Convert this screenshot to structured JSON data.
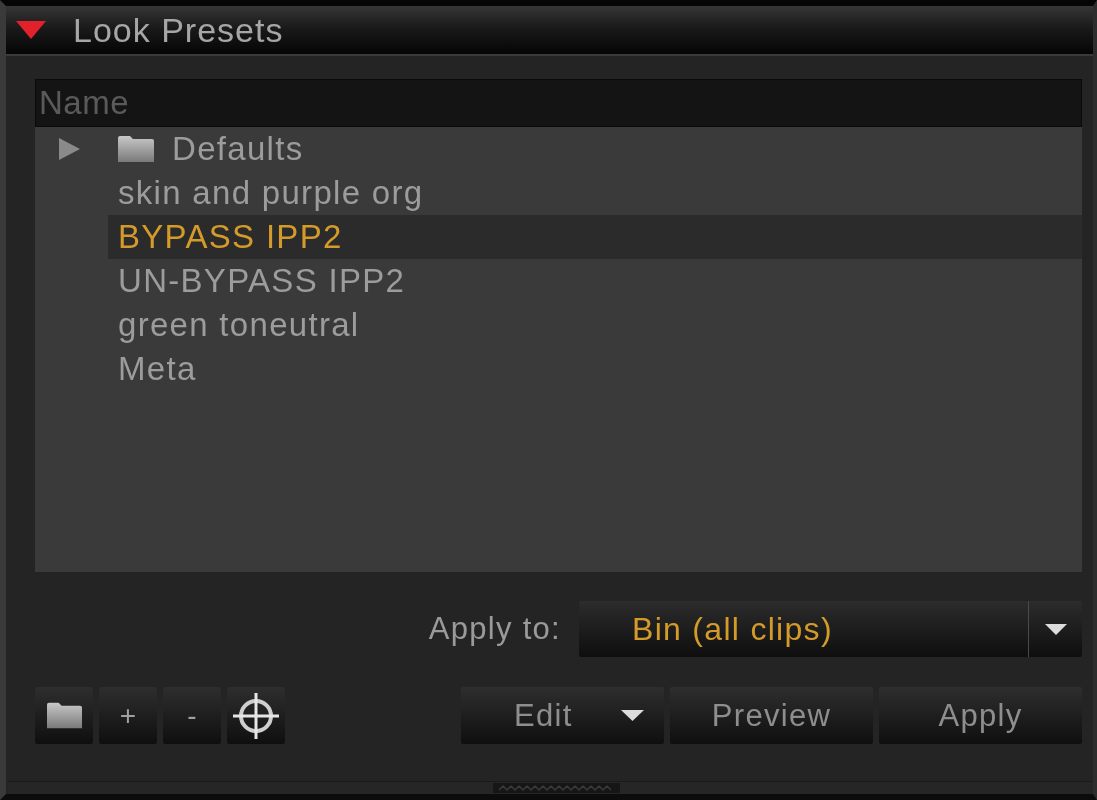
{
  "panel": {
    "title": "Look Presets",
    "expanded": true
  },
  "presets": {
    "columns": [
      "Name"
    ],
    "items": [
      {
        "kind": "folder",
        "name": "Defaults",
        "expanded": false,
        "selected": false
      },
      {
        "kind": "preset",
        "name": "skin and purple org",
        "selected": false
      },
      {
        "kind": "preset",
        "name": "BYPASS IPP2",
        "selected": true
      },
      {
        "kind": "preset",
        "name": "UN-BYPASS IPP2",
        "selected": false
      },
      {
        "kind": "preset",
        "name": "green toneutral",
        "selected": false
      },
      {
        "kind": "preset",
        "name": "Meta",
        "selected": false
      }
    ]
  },
  "apply_to": {
    "label": "Apply to:",
    "value": "Bin (all clips)"
  },
  "tools": [
    {
      "kind": "folder"
    },
    {
      "kind": "text",
      "label": "+"
    },
    {
      "kind": "text",
      "label": "-"
    },
    {
      "kind": "crosshair"
    }
  ],
  "buttons": [
    {
      "label": "Edit",
      "has_menu": true
    },
    {
      "label": "Preview",
      "has_menu": false
    },
    {
      "label": "Apply",
      "has_menu": false
    }
  ]
}
